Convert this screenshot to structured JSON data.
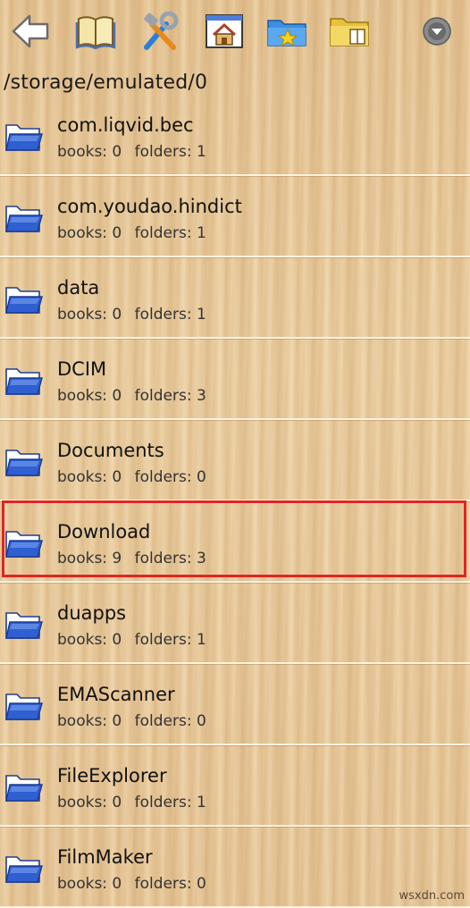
{
  "toolbar": {
    "buttons": [
      {
        "id": "back",
        "icon": "back-arrow-icon"
      },
      {
        "id": "library",
        "icon": "book-icon"
      },
      {
        "id": "tools",
        "icon": "tools-icon"
      },
      {
        "id": "home",
        "icon": "home-icon"
      },
      {
        "id": "favorites",
        "icon": "favorite-folder-icon"
      },
      {
        "id": "book-folder",
        "icon": "book-folder-icon"
      },
      {
        "id": "menu",
        "icon": "dropdown-circle-icon"
      }
    ]
  },
  "path": "/storage/emulated/0",
  "labels": {
    "books": "books:",
    "folders": "folders:"
  },
  "folders": [
    {
      "name": "com.liqvid.bec",
      "books": "0",
      "folders": "1"
    },
    {
      "name": "com.youdao.hindict",
      "books": "0",
      "folders": "1"
    },
    {
      "name": "data",
      "books": "0",
      "folders": "1"
    },
    {
      "name": "DCIM",
      "books": "0",
      "folders": "3"
    },
    {
      "name": "Documents",
      "books": "0",
      "folders": "0"
    },
    {
      "name": "Download",
      "books": "9",
      "folders": "3",
      "highlighted": true
    },
    {
      "name": "duapps",
      "books": "0",
      "folders": "1"
    },
    {
      "name": "EMAScanner",
      "books": "0",
      "folders": "0"
    },
    {
      "name": "FileExplorer",
      "books": "0",
      "folders": "1"
    },
    {
      "name": "FilmMaker",
      "books": "0",
      "folders": "0"
    }
  ],
  "colors": {
    "highlight": "#e02525",
    "folder_blue": "#2f5fd0"
  },
  "watermark": "wsxdn.com"
}
